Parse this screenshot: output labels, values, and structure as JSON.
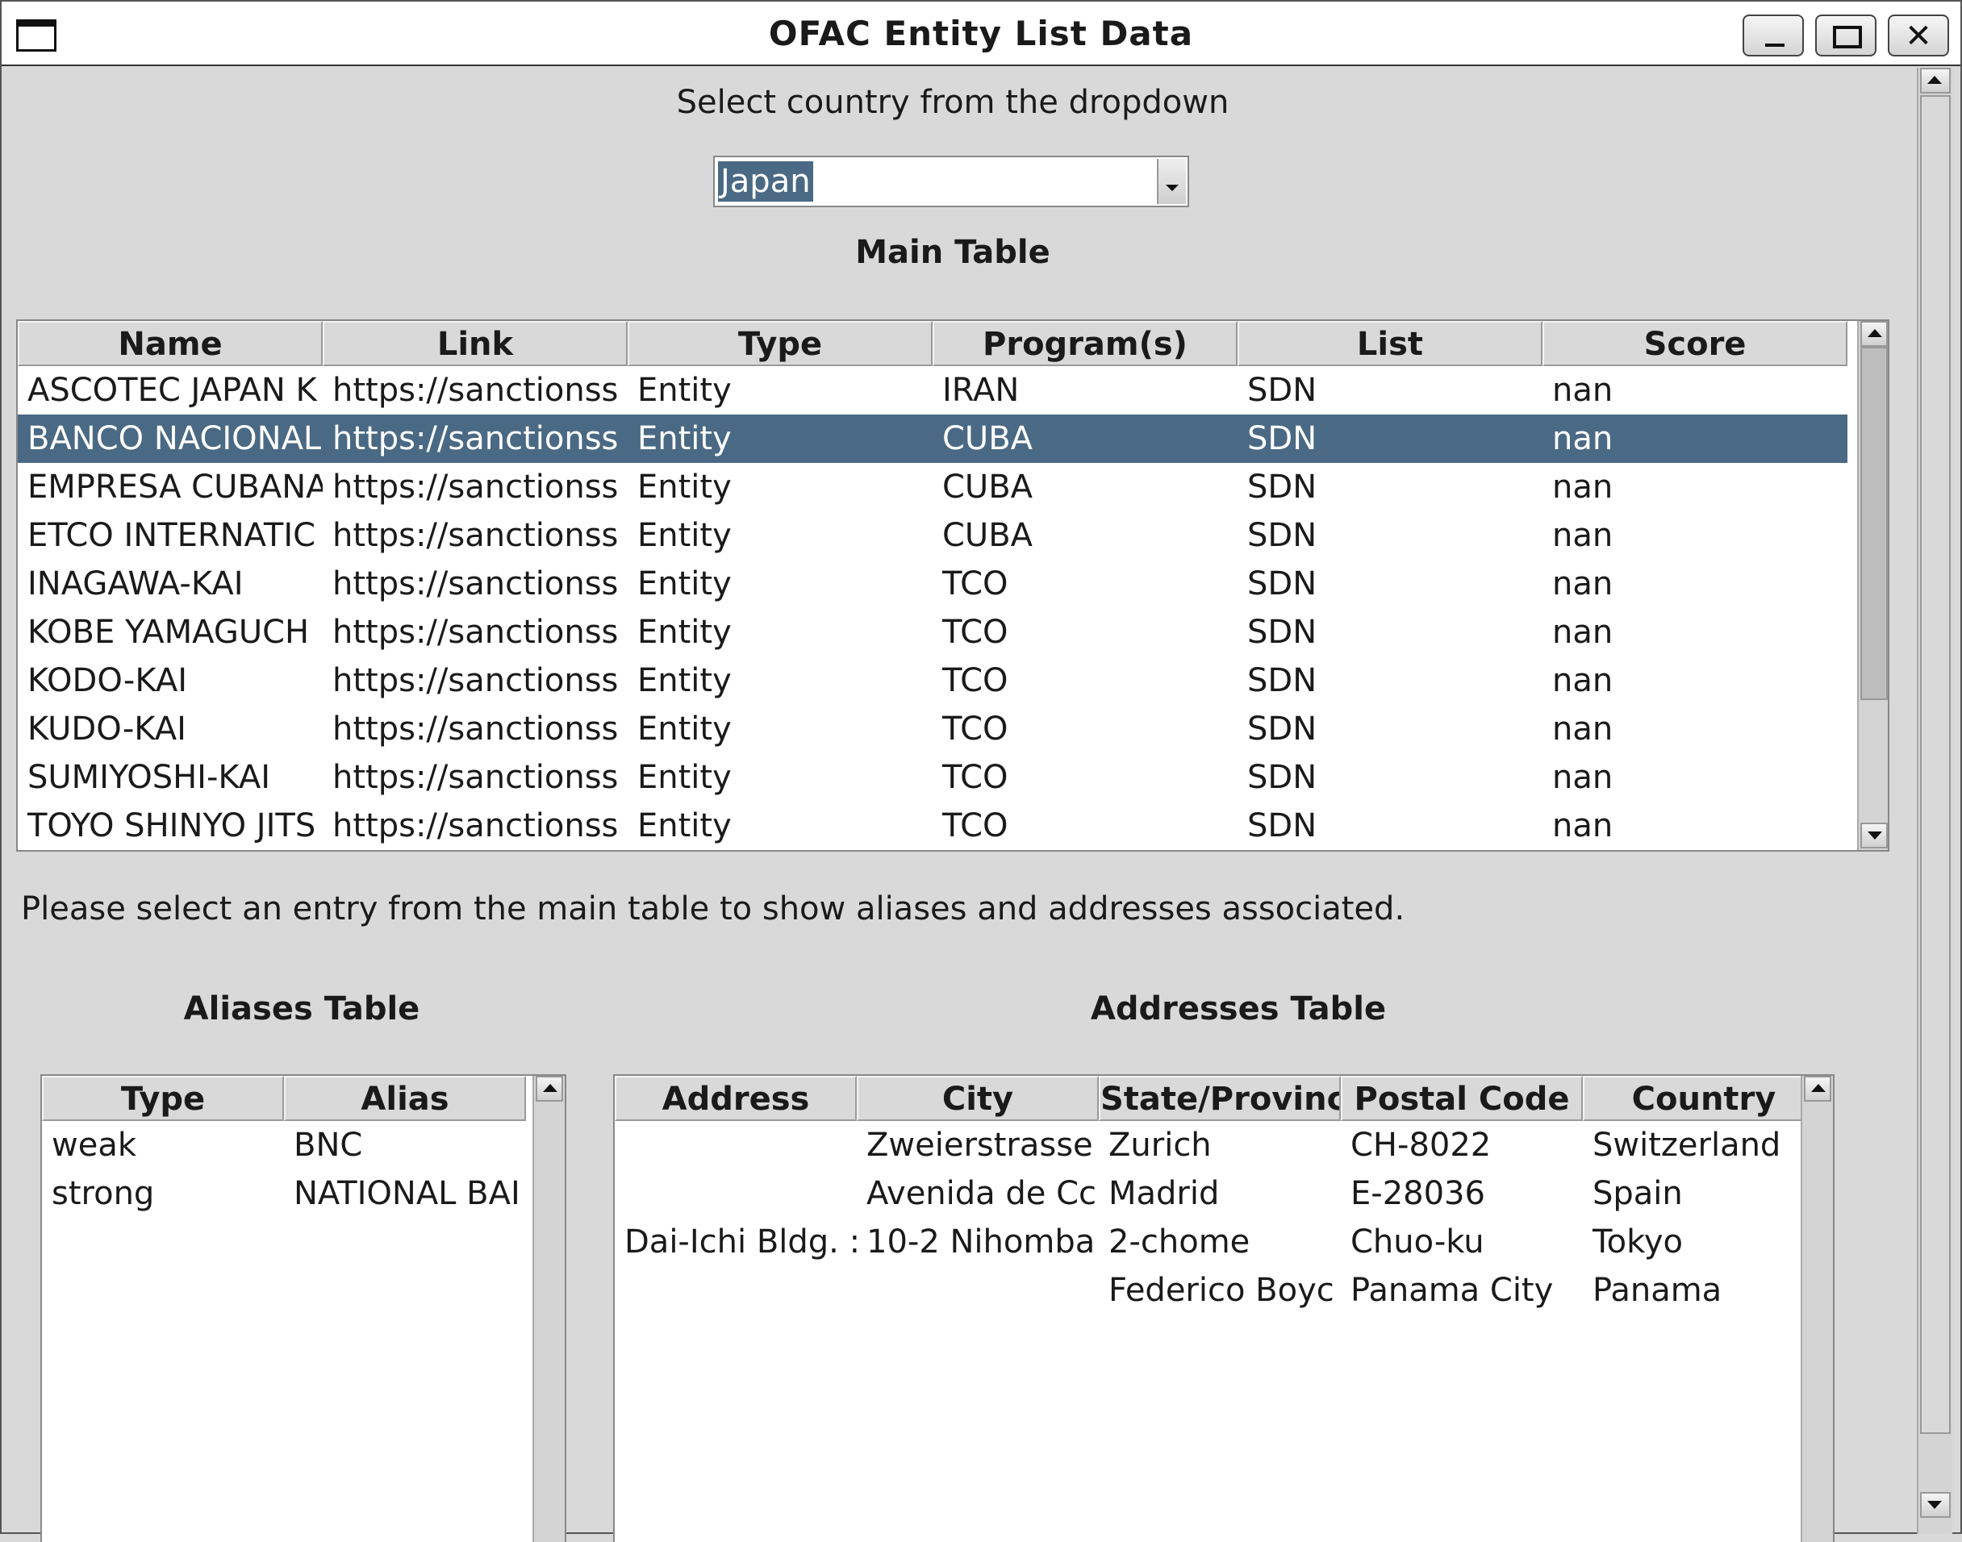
{
  "window": {
    "title": "OFAC Entity List Data",
    "controls": {
      "minimize": "minimize-icon",
      "maximize": "maximize-icon",
      "close": "✕"
    }
  },
  "country": {
    "prompt": "Select country from the dropdown",
    "selected": "Japan"
  },
  "main_table": {
    "heading": "Main Table",
    "columns": [
      "Name",
      "Link",
      "Type",
      "Program(s)",
      "List",
      "Score"
    ],
    "rows": [
      [
        "ASCOTEC JAPAN K",
        "https://sanctionss",
        "Entity",
        "IRAN",
        "SDN",
        "nan"
      ],
      [
        "BANCO NACIONAL",
        "https://sanctionss",
        "Entity",
        "CUBA",
        "SDN",
        "nan"
      ],
      [
        "EMPRESA CUBANA",
        "https://sanctionss",
        "Entity",
        "CUBA",
        "SDN",
        "nan"
      ],
      [
        "ETCO INTERNATIC",
        "https://sanctionss",
        "Entity",
        "CUBA",
        "SDN",
        "nan"
      ],
      [
        "INAGAWA-KAI",
        "https://sanctionss",
        "Entity",
        "TCO",
        "SDN",
        "nan"
      ],
      [
        "KOBE YAMAGUCH",
        "https://sanctionss",
        "Entity",
        "TCO",
        "SDN",
        "nan"
      ],
      [
        "KODO-KAI",
        "https://sanctionss",
        "Entity",
        "TCO",
        "SDN",
        "nan"
      ],
      [
        "KUDO-KAI",
        "https://sanctionss",
        "Entity",
        "TCO",
        "SDN",
        "nan"
      ],
      [
        "SUMIYOSHI-KAI",
        "https://sanctionss",
        "Entity",
        "TCO",
        "SDN",
        "nan"
      ],
      [
        "TOYO SHINYO JITS",
        "https://sanctionss",
        "Entity",
        "TCO",
        "SDN",
        "nan"
      ]
    ],
    "selected_row": 1
  },
  "instruction": "Please select an entry from the main table to show aliases and addresses associated.",
  "aliases_table": {
    "heading": "Aliases Table",
    "columns": [
      "Type",
      "Alias"
    ],
    "rows": [
      [
        "weak",
        "BNC"
      ],
      [
        "strong",
        "NATIONAL BAI"
      ]
    ]
  },
  "addresses_table": {
    "heading": "Addresses Table",
    "columns": [
      "Address",
      "City",
      "State/Provinc",
      "Postal Code",
      "Country"
    ],
    "rows": [
      [
        "",
        "Zweierstrasse",
        "Zurich",
        "CH-8022",
        "Switzerland"
      ],
      [
        "",
        "Avenida de Cc",
        "Madrid",
        "E-28036",
        "Spain"
      ],
      [
        "Dai-Ichi Bldg. :",
        "10-2 Nihomba",
        "2-chome",
        "Chuo-ku",
        "Tokyo"
      ],
      [
        "",
        "",
        "Federico Boyc",
        "Panama City",
        "Panama"
      ]
    ]
  },
  "colors": {
    "selection": "#4a6984",
    "background": "#d9d9d9"
  }
}
